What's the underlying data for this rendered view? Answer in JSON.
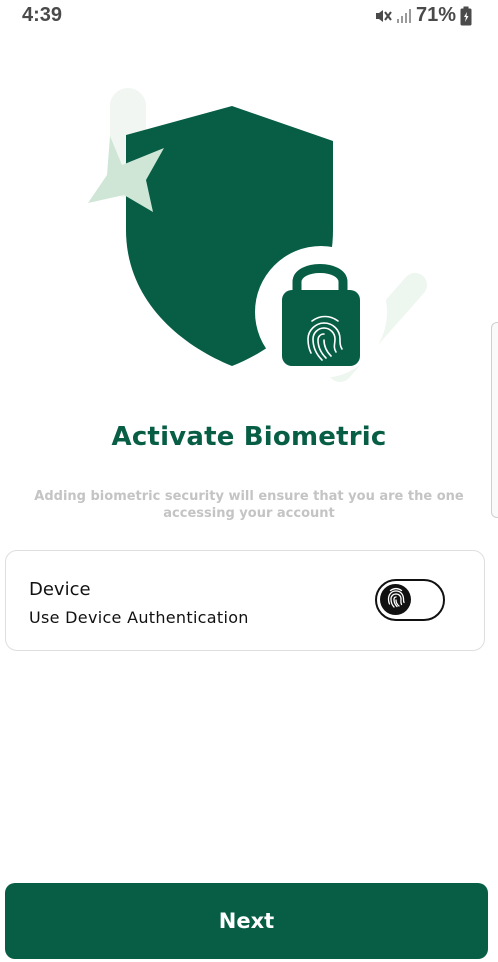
{
  "status_bar": {
    "time": "4:39",
    "battery_percent": "71%",
    "icons": [
      "mute-icon",
      "signal-icon",
      "battery-icon"
    ]
  },
  "hero": {
    "illustration": "shield-lock-fingerprint-illustration",
    "colors": {
      "shield": "#075e45",
      "star": "#cfe6d6",
      "check": "#eef6f0"
    }
  },
  "main": {
    "title": "Activate Biometric",
    "subtitle": "Adding biometric security will ensure that you are the one accessing your account"
  },
  "device_card": {
    "title": "Device",
    "subtitle": "Use Device Authentication",
    "toggle_icon": "fingerprint-icon",
    "toggle_on": false
  },
  "footer": {
    "next_label": "Next"
  },
  "colors": {
    "accent": "#075e45",
    "muted_text": "#c4c4c4"
  }
}
